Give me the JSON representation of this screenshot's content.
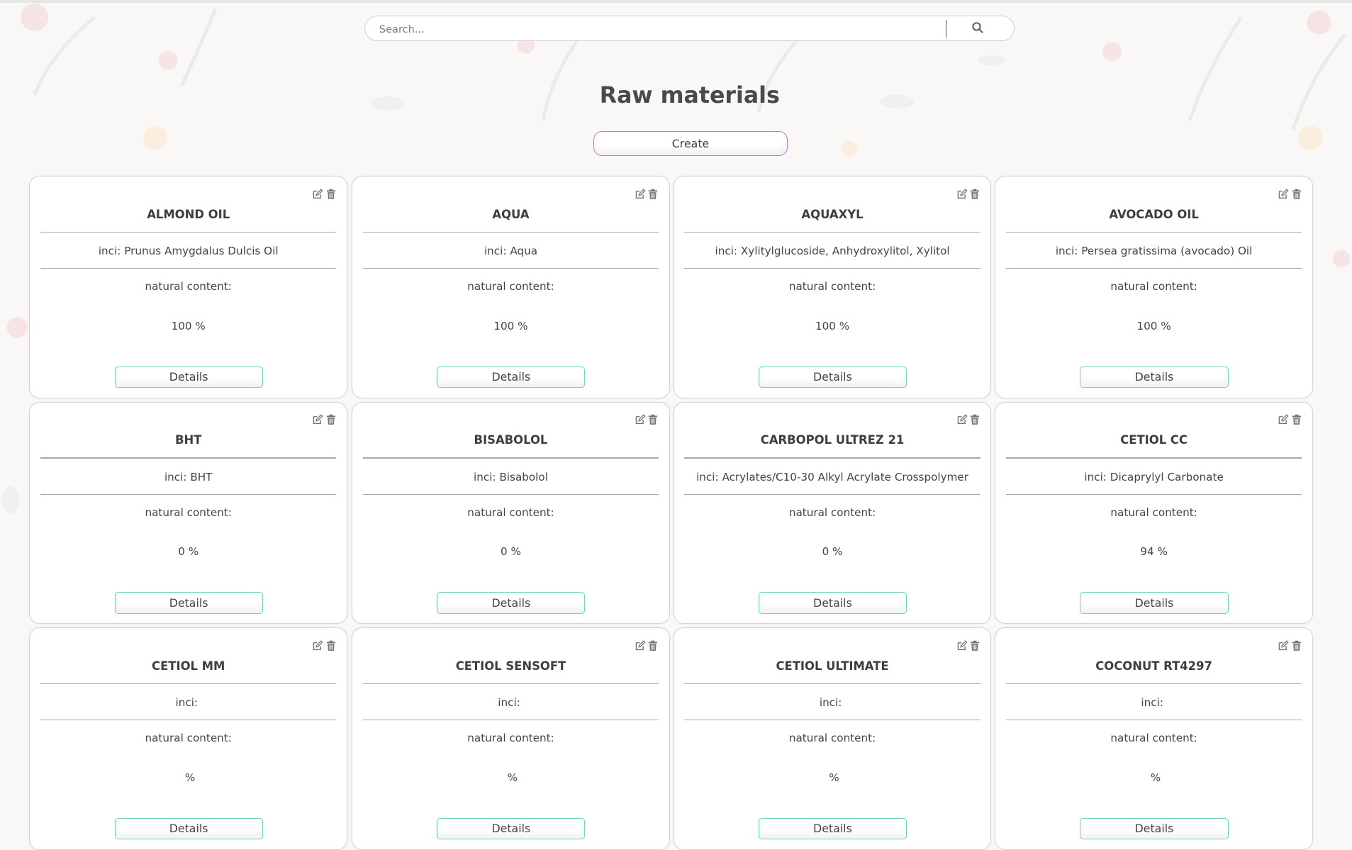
{
  "search": {
    "placeholder": "Search..."
  },
  "page_title": "Raw materials",
  "create_label": "Create",
  "labels": {
    "inci_prefix": "inci: ",
    "natural_content": "natural content:",
    "details": "Details",
    "percent_suffix": " %"
  },
  "materials": [
    {
      "name": "ALMOND OIL",
      "inci": "Prunus Amygdalus Dulcis Oil",
      "natural": "100"
    },
    {
      "name": "AQUA",
      "inci": "Aqua",
      "natural": "100"
    },
    {
      "name": "AQUAXYL",
      "inci": "Xylitylglucoside, Anhydroxylitol, Xylitol",
      "natural": "100"
    },
    {
      "name": "AVOCADO OIL",
      "inci": "Persea gratissima (avocado) Oil",
      "natural": "100"
    },
    {
      "name": "BHT",
      "inci": "BHT",
      "natural": "0"
    },
    {
      "name": "BISABOLOL",
      "inci": "Bisabolol",
      "natural": "0"
    },
    {
      "name": "CARBOPOL ULTREZ 21",
      "inci": "Acrylates/C10-30 Alkyl Acrylate Crosspolymer",
      "natural": "0"
    },
    {
      "name": "CETIOL CC",
      "inci": "Dicaprylyl Carbonate",
      "natural": "94"
    },
    {
      "name": "CETIOL MM",
      "inci": "",
      "natural": ""
    },
    {
      "name": "CETIOL SENSOFT",
      "inci": "",
      "natural": ""
    },
    {
      "name": "CETIOL ULTIMATE",
      "inci": "",
      "natural": ""
    },
    {
      "name": "COCONUT RT4297",
      "inci": "",
      "natural": ""
    }
  ],
  "icons": {
    "edit": "edit-icon",
    "delete": "trash-icon",
    "search": "search-icon"
  },
  "colors": {
    "create_border": "#d670d9",
    "details_border": "#6dd6b7"
  }
}
